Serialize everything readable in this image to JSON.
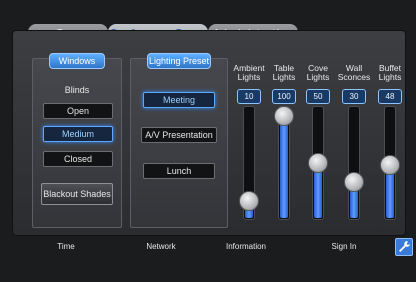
{
  "tabs": [
    {
      "label": "Gym",
      "active": false
    },
    {
      "label": "Conference Room",
      "active": true
    },
    {
      "label": "Administration",
      "active": false
    }
  ],
  "windows": {
    "title": "Windows",
    "blinds_label": "Blinds",
    "buttons": [
      {
        "label": "Open",
        "selected": false
      },
      {
        "label": "Medium",
        "selected": true
      },
      {
        "label": "Closed",
        "selected": false
      }
    ],
    "shades_label": "Blackout Shades"
  },
  "lighting": {
    "title": "Lighting Preset",
    "presets": [
      {
        "label": "Meeting",
        "selected": true
      },
      {
        "label": "A/V Presentation",
        "selected": false
      },
      {
        "label": "Lunch",
        "selected": false
      }
    ]
  },
  "faders": [
    {
      "name": "Ambient Lights",
      "value": 10,
      "level": 0.1
    },
    {
      "name": "Table Lights",
      "value": 100,
      "level": 1.0
    },
    {
      "name": "Cove Lights",
      "value": 50,
      "level": 0.5
    },
    {
      "name": "Wall Sconces",
      "value": 30,
      "level": 0.3
    },
    {
      "name": "Buffet Lights",
      "value": 48,
      "level": 0.48
    }
  ],
  "nav": {
    "time": "Time",
    "network": "Network",
    "information": "Information",
    "sign_in": "Sign In"
  },
  "colors": {
    "accent": "#2f76c8",
    "fill": "#5c9cff"
  },
  "icons": {
    "settings": "wrench-icon"
  }
}
